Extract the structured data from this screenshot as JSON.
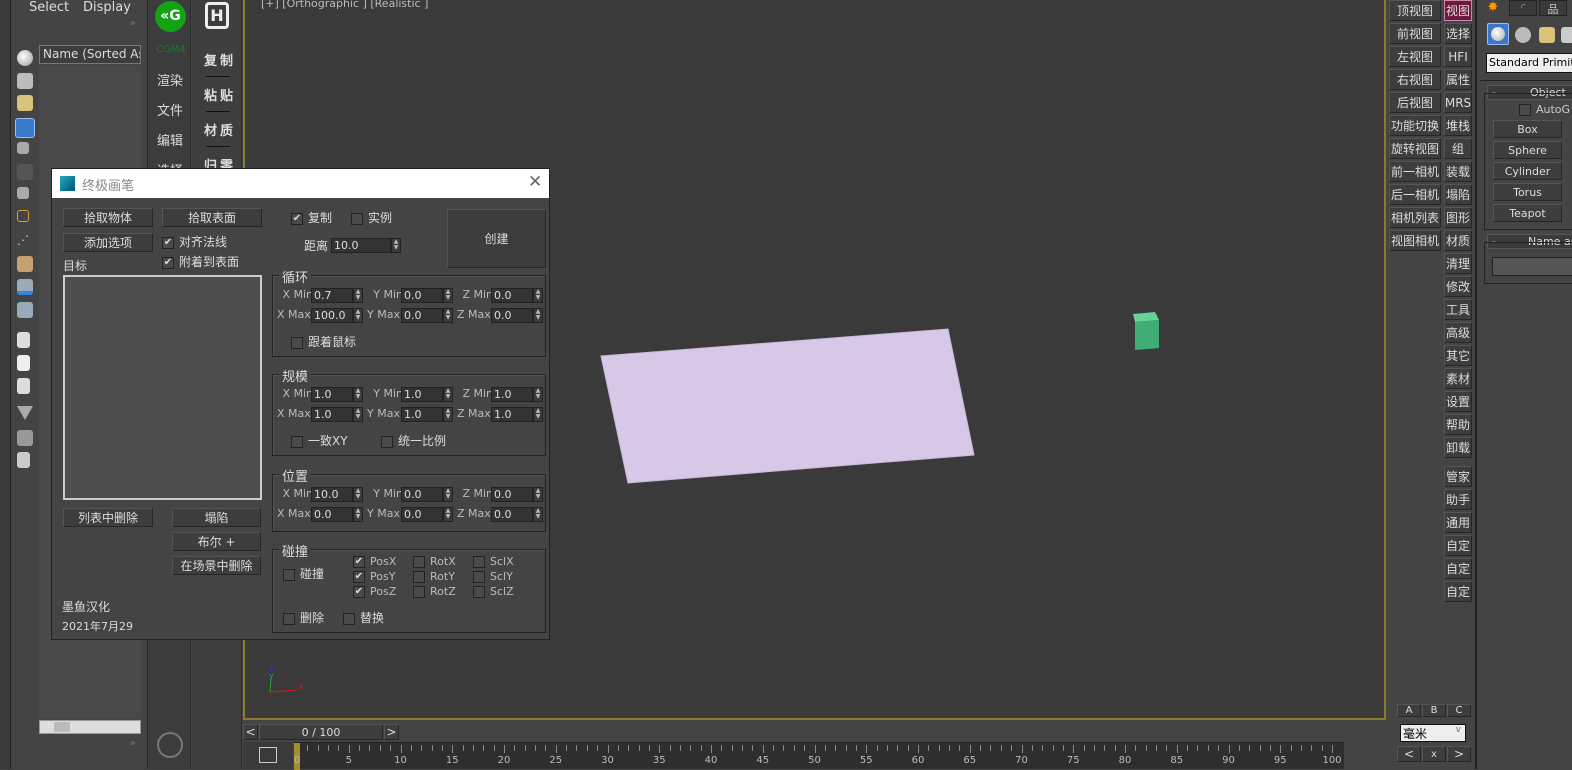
{
  "menu": {
    "select": "Select",
    "display": "Display"
  },
  "scene_explorer": {
    "column_header": "Name (Sorted Asc"
  },
  "cgm_panel": {
    "logo": "CGM4",
    "items": [
      "渲染",
      "文件",
      "编辑",
      "选择"
    ]
  },
  "h_panel": {
    "items": [
      "复制",
      "粘贴",
      "材质",
      "归零"
    ]
  },
  "viewport": {
    "label": "[+] [Orthographic ] [Realistic ]",
    "axis": {
      "x": "x",
      "y": "y",
      "z": "z"
    },
    "plane_color": "#d7c8e8",
    "cube_color": "#3fae76"
  },
  "timeline": {
    "frame": "0 / 100",
    "prev": "<",
    "next": ">",
    "ticks": [
      "0",
      "5",
      "10",
      "15",
      "20",
      "25",
      "30",
      "35",
      "40",
      "45",
      "50",
      "55",
      "60",
      "65",
      "70",
      "75",
      "80",
      "85",
      "90",
      "95",
      "100"
    ]
  },
  "right_col1": [
    "顶视图",
    "前视图",
    "左视图",
    "右视图",
    "后视图",
    "功能切换",
    "旋转视图",
    "前一相机",
    "后一相机",
    "相机列表",
    "视图相机"
  ],
  "right_col2": [
    "视图",
    "选择",
    "HFI",
    "属性",
    "MRS",
    "堆栈",
    "组",
    "装载",
    "塌陷",
    "图形",
    "材质",
    "清理",
    "修改",
    "工具",
    "高级",
    "其它",
    "素材",
    "设置",
    "帮助",
    "卸载",
    "管家",
    "助手",
    "通用",
    "自定",
    "自定",
    "自定"
  ],
  "abc": [
    "A",
    "B",
    "C"
  ],
  "unit": "毫米",
  "nav": [
    "<",
    "x",
    ">"
  ],
  "command_panel": {
    "dropdown": "Standard Primitiv",
    "rollout_object": "Object",
    "autogrid": "AutoG",
    "buttons": [
      "Box",
      "Sphere",
      "Cylinder",
      "Torus",
      "Teapot"
    ],
    "rollout_name": "Name ar"
  },
  "dialog": {
    "title": "终极画笔",
    "pick_object": "拾取物体",
    "pick_surface": "拾取表面",
    "add_option": "添加选项",
    "align_normal": "对齐法线",
    "attach_surface": "附着到表面",
    "target": "目标",
    "copy": "复制",
    "instance": "实例",
    "distance_label": "距离",
    "distance": "10.0",
    "create": "创建",
    "loop": {
      "title": "循环",
      "xmin": "0.7",
      "ymin": "0.0",
      "zmin": "0.0",
      "xmax": "100.0",
      "ymax": "0.0",
      "zmax": "0.0",
      "follow_mouse": "跟着鼠标"
    },
    "scale": {
      "title": "规模",
      "xmin": "1.0",
      "ymin": "1.0",
      "zmin": "1.0",
      "xmax": "1.0",
      "ymax": "1.0",
      "zmax": "1.0",
      "uniform_xy": "一致XY",
      "uniform": "统一比例"
    },
    "position": {
      "title": "位置",
      "xmin": "10.0",
      "ymin": "0.0",
      "zmin": "0.0",
      "xmax": "0.0",
      "ymax": "0.0",
      "zmax": "0.0"
    },
    "labels": {
      "xmin": "X Min",
      "ymin": "Y Min",
      "zmin": "Z Min",
      "xmax": "X Max",
      "ymax": "Y Max",
      "zmax": "Z Max"
    },
    "collision": {
      "title": "碰撞",
      "collide": "碰撞",
      "posx": "PosX",
      "posy": "PosY",
      "posz": "PosZ",
      "rotx": "RotX",
      "roty": "RotY",
      "rotz": "RotZ",
      "sclx": "SclX",
      "scly": "SclY",
      "sclz": "SclZ",
      "delete": "删除",
      "replace": "替换"
    },
    "remove_from_list": "列表中删除",
    "collapse": "塌陷",
    "boolean": "布尔 +",
    "delete_in_scene": "在场景中删除",
    "credit": "墨鱼汉化",
    "date": "2021年7月29"
  }
}
